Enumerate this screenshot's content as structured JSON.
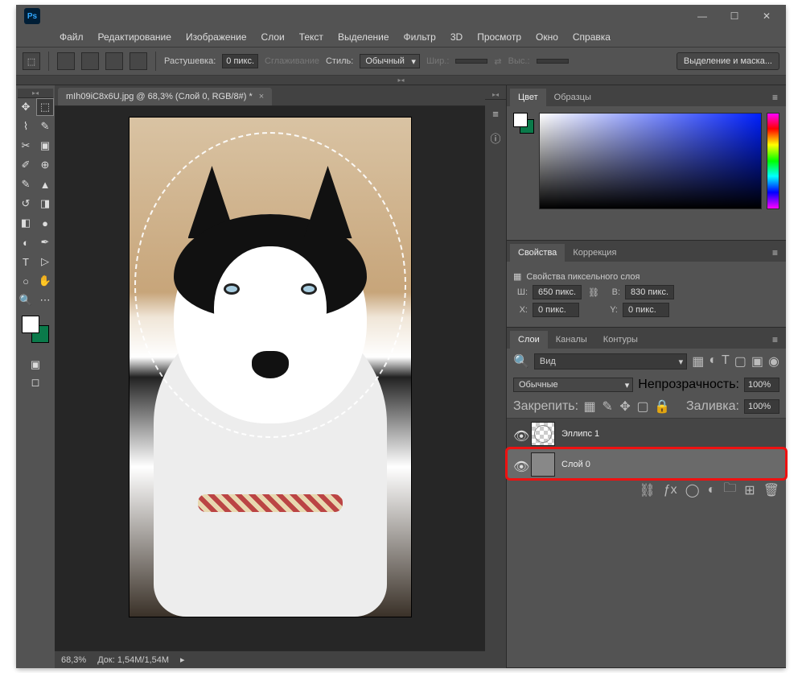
{
  "menu": {
    "file": "Файл",
    "edit": "Редактирование",
    "image": "Изображение",
    "layers": "Слои",
    "type": "Текст",
    "select": "Выделение",
    "filter": "Фильтр",
    "three_d": "3D",
    "view": "Просмотр",
    "window": "Окно",
    "help": "Справка"
  },
  "options": {
    "feather_label": "Растушевка:",
    "feather_value": "0 пикс.",
    "antialias": "Сглаживание",
    "style_label": "Стиль:",
    "style_value": "Обычный",
    "width_label": "Шир.:",
    "height_label": "Выс.:",
    "select_mask": "Выделение и маска..."
  },
  "tab": {
    "title": "mIh09iC8x6U.jpg @ 68,3% (Слой 0, RGB/8#) *"
  },
  "status": {
    "zoom": "68,3%",
    "doc": "Док: 1,54M/1,54M"
  },
  "panels": {
    "color": {
      "tab1": "Цвет",
      "tab2": "Образцы"
    },
    "props": {
      "tab1": "Свойства",
      "tab2": "Коррекция",
      "title": "Свойства пиксельного слоя",
      "w_label": "Ш:",
      "w_value": "650 пикс.",
      "h_label": "В:",
      "h_value": "830 пикс.",
      "x_label": "X:",
      "x_value": "0 пикс.",
      "y_label": "Y:",
      "y_value": "0 пикс."
    },
    "layers": {
      "tab1": "Слои",
      "tab2": "Каналы",
      "tab3": "Контуры",
      "search_label": "Вид",
      "blend": "Обычные",
      "opacity_label": "Непрозрачность:",
      "opacity_value": "100%",
      "lock_label": "Закрепить:",
      "fill_label": "Заливка:",
      "fill_value": "100%",
      "layer1": "Эллипс 1",
      "layer2": "Слой 0"
    }
  }
}
